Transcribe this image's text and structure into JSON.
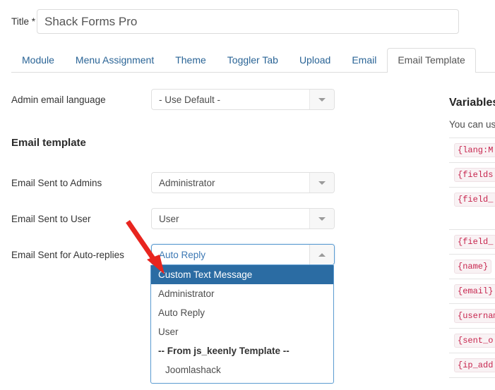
{
  "title_field": {
    "label": "Title *",
    "value": "Shack Forms Pro",
    "placeholder": ""
  },
  "tabs": [
    {
      "label": "Module",
      "active": false
    },
    {
      "label": "Menu Assignment",
      "active": false
    },
    {
      "label": "Theme",
      "active": false
    },
    {
      "label": "Toggler Tab",
      "active": false
    },
    {
      "label": "Upload",
      "active": false
    },
    {
      "label": "Email",
      "active": false
    },
    {
      "label": "Email Template",
      "active": true
    }
  ],
  "form": {
    "admin_email_language": {
      "label": "Admin email language",
      "value": "- Use Default -"
    },
    "section_heading": "Email template",
    "email_sent_to_admins": {
      "label": "Email Sent to Admins",
      "value": "Administrator"
    },
    "email_sent_to_user": {
      "label": "Email Sent to User",
      "value": "User"
    },
    "email_sent_autoreplies": {
      "label": "Email Sent for Auto-replies",
      "value": "Auto Reply"
    }
  },
  "dropdown": {
    "items": [
      {
        "label": "Custom Text Message",
        "selected": true,
        "group": false,
        "indent": false
      },
      {
        "label": "Administrator",
        "selected": false,
        "group": false,
        "indent": false
      },
      {
        "label": "Auto Reply",
        "selected": false,
        "group": false,
        "indent": false
      },
      {
        "label": "User",
        "selected": false,
        "group": false,
        "indent": false
      },
      {
        "label": "-- From js_keenly Template --",
        "selected": false,
        "group": true,
        "indent": false
      },
      {
        "label": "Joomlashack",
        "selected": false,
        "group": false,
        "indent": true
      }
    ]
  },
  "variables_panel": {
    "title": "Variables",
    "subtitle": "You can us",
    "rows": [
      {
        "code": "{lang:M"
      },
      {
        "code": "{fields"
      },
      {
        "code": "{field_"
      },
      {
        "code": "{field_"
      },
      {
        "code": "{name}"
      },
      {
        "code": "{email}"
      },
      {
        "code": "{usernam"
      },
      {
        "code": "{sent_o"
      },
      {
        "code": "{ip_add"
      }
    ]
  },
  "annotation": {
    "arrow_color": "#e8251f"
  },
  "colors": {
    "tab_link": "#2a6496",
    "highlight_bg": "#2b6ca3",
    "combo_focus_border": "#5b9bd1",
    "code_text": "#c7254e",
    "code_bg": "#f9f2f4"
  }
}
